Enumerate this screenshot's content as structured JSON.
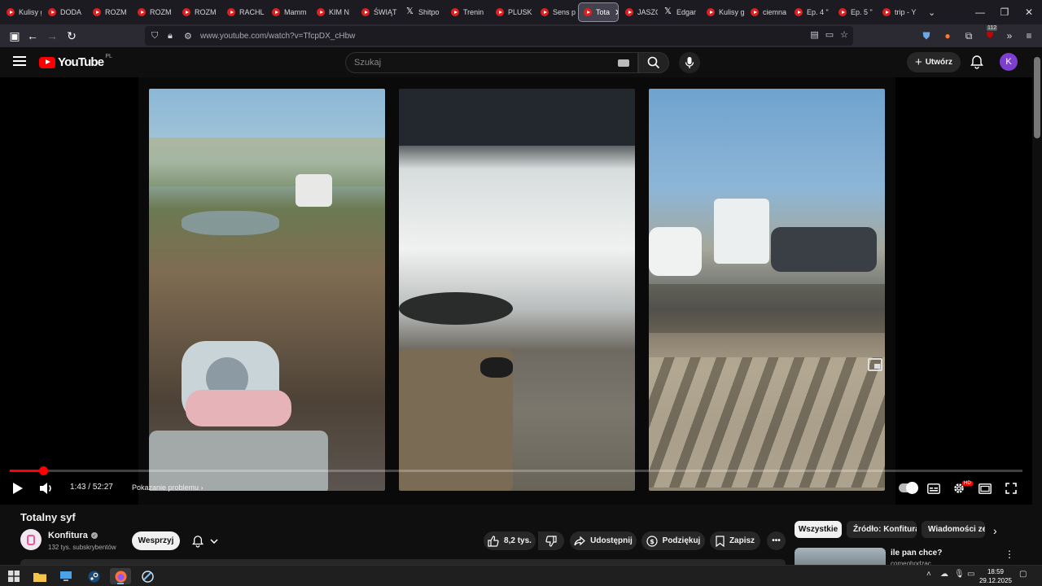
{
  "browser": {
    "tabs": [
      {
        "label": "Kulisy g",
        "icon": "youtube-icon"
      },
      {
        "label": "DODA",
        "icon": "youtube-icon"
      },
      {
        "label": "ROZM",
        "icon": "youtube-icon"
      },
      {
        "label": "ROZM",
        "icon": "youtube-icon"
      },
      {
        "label": "ROZM",
        "icon": "youtube-icon"
      },
      {
        "label": "RACHL",
        "icon": "youtube-icon"
      },
      {
        "label": "Mamm",
        "icon": "youtube-icon"
      },
      {
        "label": "KIM N",
        "icon": "youtube-icon"
      },
      {
        "label": "ŚWIĄT",
        "icon": "youtube-icon"
      },
      {
        "label": "Shitpo",
        "icon": "x-icon"
      },
      {
        "label": "Trenin",
        "icon": "youtube-icon"
      },
      {
        "label": "PLUSK",
        "icon": "youtube-icon"
      },
      {
        "label": "Sens p",
        "icon": "youtube-icon"
      },
      {
        "label": "Tota",
        "icon": "youtube-icon",
        "active": true
      },
      {
        "label": "JASZC",
        "icon": "youtube-icon"
      },
      {
        "label": "Edgar",
        "icon": "x-icon"
      },
      {
        "label": "Kulisy g",
        "icon": "youtube-icon"
      },
      {
        "label": "ciemna",
        "icon": "youtube-icon"
      },
      {
        "label": "Ep. 4 \"",
        "icon": "youtube-icon"
      },
      {
        "label": "Ep. 5 \"",
        "icon": "youtube-icon"
      },
      {
        "label": "trip - Y",
        "icon": "youtube-icon"
      }
    ],
    "url": "www.youtube.com/watch?v=TfcpDX_cHbw",
    "extension_badge": "112"
  },
  "youtube": {
    "logo_text": "YouTube",
    "country_code": "PL",
    "search_placeholder": "Szukaj",
    "create_label": "Utwórz",
    "avatar_letter": "K"
  },
  "player": {
    "current_time": "1:43",
    "separator": " / ",
    "duration": "52:27",
    "progress_fraction": 0.0327,
    "problem_label": "Pokazanie problemu",
    "hd_badge": "HD"
  },
  "video": {
    "title": "Totalny syf",
    "channel": "Konfitura",
    "subscribers": "132 tys. subskrybentów",
    "join_label": "Wesprzyj",
    "likes": "8,2 tys.",
    "share_label": "Udostępnij",
    "thanks_label": "Podziękuj",
    "save_label": "Zapisz"
  },
  "sidebar": {
    "chips": [
      "Wszystkie",
      "Źródło: Konfitura",
      "Wiadomości ze"
    ],
    "rec_title": "ile pan chce?",
    "rec_author": "comeohodzac"
  },
  "taskbar": {
    "time": "18:59",
    "date": "29.12.2025"
  },
  "colors": {
    "accent": "#ff0000",
    "background": "#0f0f0f",
    "avatar": "#7e3fd1"
  }
}
